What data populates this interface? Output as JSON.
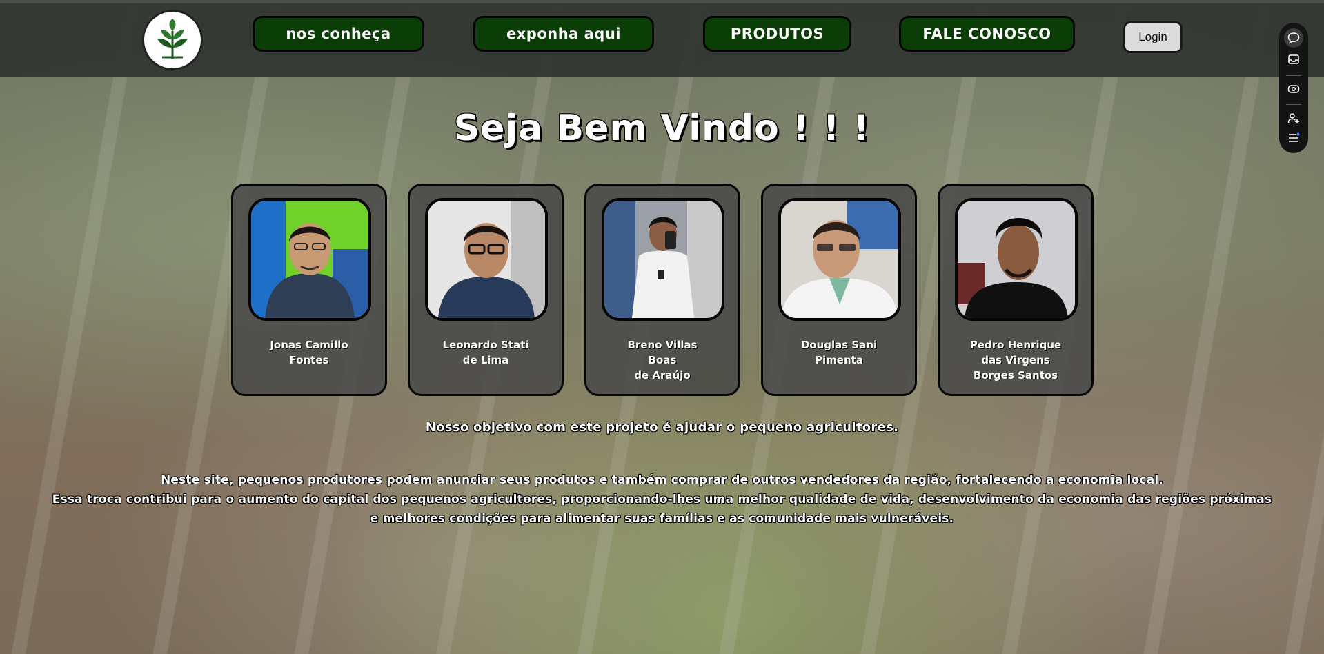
{
  "header": {
    "nav": [
      {
        "label": "nos conheça"
      },
      {
        "label": "exponha aqui"
      },
      {
        "label": "PRODUTOS"
      },
      {
        "label": "FALE CONOSCO"
      }
    ],
    "login_label": "Login"
  },
  "side_toolbar": {
    "icons": [
      "chat-icon",
      "inbox-icon",
      "eye-icon",
      "add-user-icon",
      "menu-icon"
    ]
  },
  "main": {
    "title": "Seja Bem Vindo ! ! !",
    "team": [
      {
        "name": "Jonas Camillo\nFontes"
      },
      {
        "name": "Leonardo Stati\nde Lima"
      },
      {
        "name": "Breno Villas\nBoas\nde Araújo"
      },
      {
        "name": "Douglas Sani\nPimenta"
      },
      {
        "name": "Pedro Henrique\ndas Virgens\nBorges Santos"
      }
    ],
    "objective": "Nosso objetivo com este projeto é ajudar o pequeno agricultores.",
    "description": [
      "Neste site, pequenos produtores podem anunciar seus produtos e também comprar de outros vendedores da região, fortalecendo a economia local.",
      "Essa troca contribui para o aumento do capital dos pequenos agricultores, proporcionando-lhes uma melhor qualidade de vida, desenvolvimento da economia das regiões próximas",
      "e melhores condições para alimentar suas famílias e as comunidade mais vulneráveis."
    ]
  },
  "colors": {
    "nav_bg": "#0b3d06",
    "header_bg": "#303430",
    "card_bg": "#484848",
    "text": "#ffffff"
  }
}
